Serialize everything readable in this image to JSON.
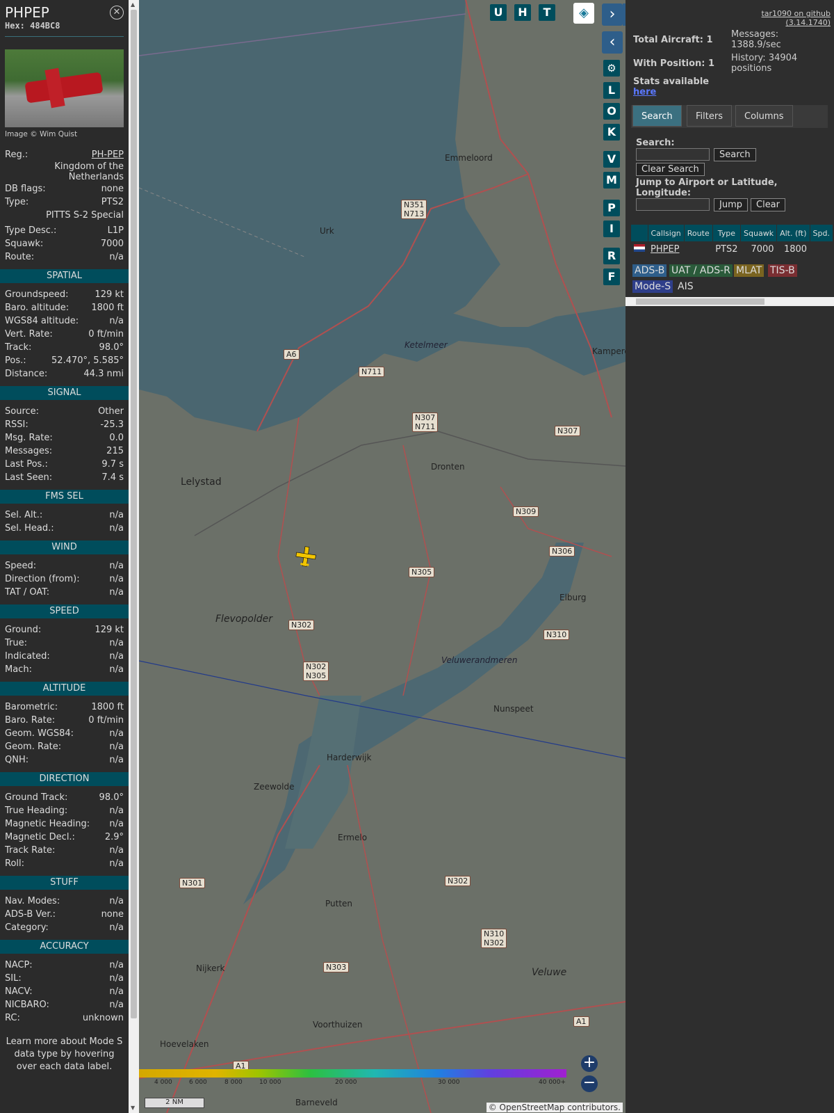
{
  "selected": {
    "callsign": "PHPEP",
    "hex": "Hex: 484BC8",
    "image_credit": "Image © Wim Quist",
    "rows1": [
      [
        "Reg.:",
        "PH-PEP"
      ]
    ],
    "country": "Kingdom of the Netherlands",
    "rows2": [
      [
        "DB flags:",
        "none"
      ],
      [
        "Type:",
        "PTS2"
      ]
    ],
    "type_name": "PITTS S-2 Special",
    "rows3": [
      [
        "Type Desc.:",
        "L1P"
      ],
      [
        "Squawk:",
        "7000"
      ],
      [
        "Route:",
        "n/a"
      ]
    ],
    "sections": [
      {
        "title": "SPATIAL",
        "rows": [
          [
            "Groundspeed:",
            "129 kt"
          ],
          [
            "Baro. altitude:",
            "1800 ft"
          ],
          [
            "WGS84 altitude:",
            "n/a"
          ],
          [
            "Vert. Rate:",
            "0 ft/min"
          ],
          [
            "Track:",
            "98.0°"
          ],
          [
            "Pos.:",
            "52.470°, 5.585°"
          ],
          [
            "Distance:",
            "44.3 nmi"
          ]
        ]
      },
      {
        "title": "SIGNAL",
        "rows": [
          [
            "Source:",
            "Other"
          ],
          [
            "RSSI:",
            "-25.3"
          ],
          [
            "Msg. Rate:",
            "0.0"
          ],
          [
            "Messages:",
            "215"
          ],
          [
            "Last Pos.:",
            "9.7 s"
          ],
          [
            "Last Seen:",
            "7.4 s"
          ]
        ]
      },
      {
        "title": "FMS SEL",
        "rows": [
          [
            "Sel. Alt.:",
            "n/a"
          ],
          [
            "Sel. Head.:",
            "n/a"
          ]
        ]
      },
      {
        "title": "WIND",
        "rows": [
          [
            "Speed:",
            "n/a"
          ],
          [
            "Direction (from):",
            "n/a"
          ],
          [
            "TAT / OAT:",
            "n/a"
          ]
        ]
      },
      {
        "title": "SPEED",
        "rows": [
          [
            "Ground:",
            "129 kt"
          ],
          [
            "True:",
            "n/a"
          ],
          [
            "Indicated:",
            "n/a"
          ],
          [
            "Mach:",
            "n/a"
          ]
        ]
      },
      {
        "title": "ALTITUDE",
        "rows": [
          [
            "Barometric:",
            "1800 ft"
          ],
          [
            "Baro. Rate:",
            "0 ft/min"
          ],
          [
            "Geom. WGS84:",
            "n/a"
          ],
          [
            "Geom. Rate:",
            "n/a"
          ],
          [
            "QNH:",
            "n/a"
          ]
        ]
      },
      {
        "title": "DIRECTION",
        "rows": [
          [
            "Ground Track:",
            "98.0°"
          ],
          [
            "True Heading:",
            "n/a"
          ],
          [
            "Magnetic Heading:",
            "n/a"
          ],
          [
            "Magnetic Decl.:",
            "2.9°"
          ],
          [
            "Track Rate:",
            "n/a"
          ],
          [
            "Roll:",
            "n/a"
          ]
        ]
      },
      {
        "title": "STUFF",
        "rows": [
          [
            "Nav. Modes:",
            "n/a"
          ],
          [
            "ADS-B Ver.:",
            "none"
          ],
          [
            "Category:",
            "n/a"
          ]
        ]
      },
      {
        "title": "ACCURACY",
        "rows": [
          [
            "NACP:",
            "n/a"
          ],
          [
            "SIL:",
            "n/a"
          ],
          [
            "NACV:",
            "n/a"
          ],
          [
            "NICBARO:",
            "n/a"
          ],
          [
            "RC:",
            "unknown"
          ]
        ]
      }
    ],
    "footnote": "Learn more about Mode S data type by hovering over each data label."
  },
  "map": {
    "buttons": [
      "U",
      "H",
      "T"
    ],
    "side_buttons": [
      "L",
      "O",
      "K",
      "V",
      "M",
      "P",
      "I",
      "R",
      "F"
    ],
    "towns": [
      "Emmeloord",
      "Urk",
      "Lelystad",
      "Dronten",
      "Flevopolder",
      "Elburg",
      "Harderwijk",
      "Zeewolde",
      "Nunspeet",
      "Ermelo",
      "Putten",
      "Nijkerk",
      "Voorthuizen",
      "Hoevelaken",
      "Barneveld",
      "Veluwe",
      "Ketelmeer",
      "Veluwerandmeren",
      "Kampere"
    ],
    "roads": [
      "N351\nN713",
      "N711",
      "N307\nN711",
      "N307",
      "N309",
      "N306",
      "N305",
      "N302",
      "N302\nN305",
      "N310",
      "N301",
      "N302",
      "N310\nN302",
      "N303",
      "A6",
      "A1",
      "A1"
    ],
    "scale": "2 NM",
    "attribution": "© OpenStreetMap contributors.",
    "alt_ticks": [
      "4 000",
      "6 000",
      "8 000",
      "10 000",
      "20 000",
      "30 000",
      "40 000+"
    ]
  },
  "panel": {
    "version": "tar1090 on github (3.14.1740)",
    "total": "Total Aircraft: 1",
    "with_pos": "With Position: 1",
    "messages": "Messages: 1388.9/sec",
    "history": "History: 34904 positions",
    "stats": "Stats available",
    "here": "here",
    "tabs": [
      "Search",
      "Filters",
      "Columns"
    ],
    "search_label": "Search:",
    "search_btn": "Search",
    "clear_search": "Clear Search",
    "jump_label": "Jump to Airport or Latitude, Longitude:",
    "jump_btn": "Jump",
    "clear_btn": "Clear",
    "columns": [
      "",
      "Callsign",
      "Route",
      "Type",
      "Squawk",
      "Alt. (ft)",
      "Spd."
    ],
    "row": {
      "callsign": "PHPEP",
      "route": "",
      "type": "PTS2",
      "squawk": "7000",
      "alt": "1800"
    },
    "sources": [
      "ADS-B",
      "UAT / ADS-R",
      "MLAT",
      "TIS-B",
      "Mode-S",
      "AIS"
    ]
  }
}
